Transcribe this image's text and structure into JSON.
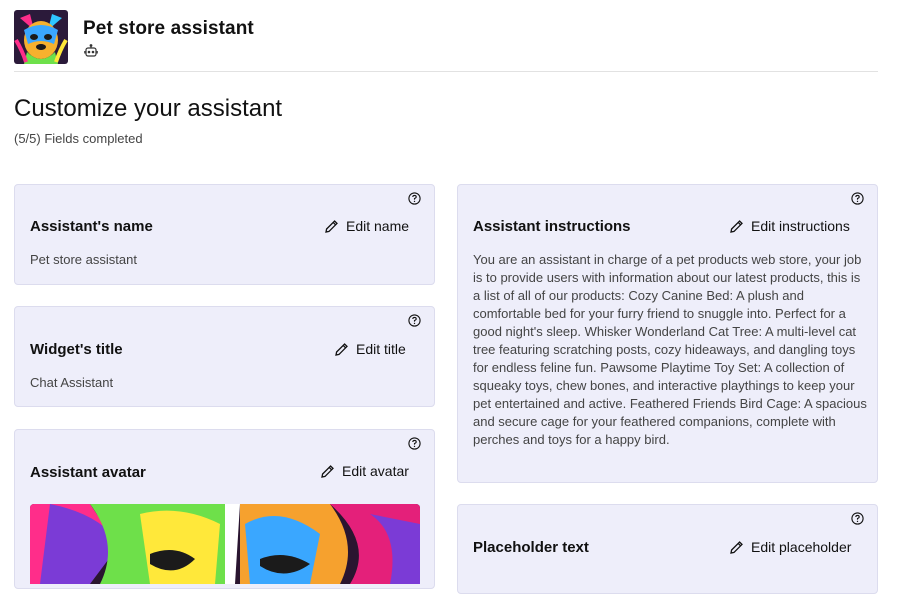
{
  "header": {
    "app_title": "Pet store assistant",
    "logo_icon": "dog-logo",
    "bot_icon": "bot-icon"
  },
  "page": {
    "title": "Customize your assistant",
    "progress": "(5/5) Fields completed"
  },
  "cards": {
    "name": {
      "title": "Assistant's name",
      "edit_label": "Edit name",
      "value": "Pet store assistant"
    },
    "widget_title": {
      "title": "Widget's title",
      "edit_label": "Edit title",
      "value": "Chat Assistant"
    },
    "avatar": {
      "title": "Assistant avatar",
      "edit_label": "Edit avatar"
    },
    "instructions": {
      "title": "Assistant instructions",
      "edit_label": "Edit instructions",
      "value": "You are an assistant in charge of a pet products web store, your job is to provide users with information about our latest products, this is a list of all of our products: Cozy Canine Bed: A plush and comfortable bed for your furry friend to snuggle into. Perfect for a good night's sleep. Whisker Wonderland Cat Tree: A multi-level cat tree featuring scratching posts, cozy hideaways, and dangling toys for endless feline fun. Pawsome Playtime Toy Set: A collection of squeaky toys, chew bones, and interactive playthings to keep your pet entertained and active. Feathered Friends Bird Cage: A spacious and secure cage for your feathered companions, complete with perches and toys for a happy bird."
    },
    "placeholder": {
      "title": "Placeholder text",
      "edit_label": "Edit placeholder"
    }
  },
  "icons": {
    "help": "question-circle-icon",
    "edit": "pencil-icon"
  }
}
